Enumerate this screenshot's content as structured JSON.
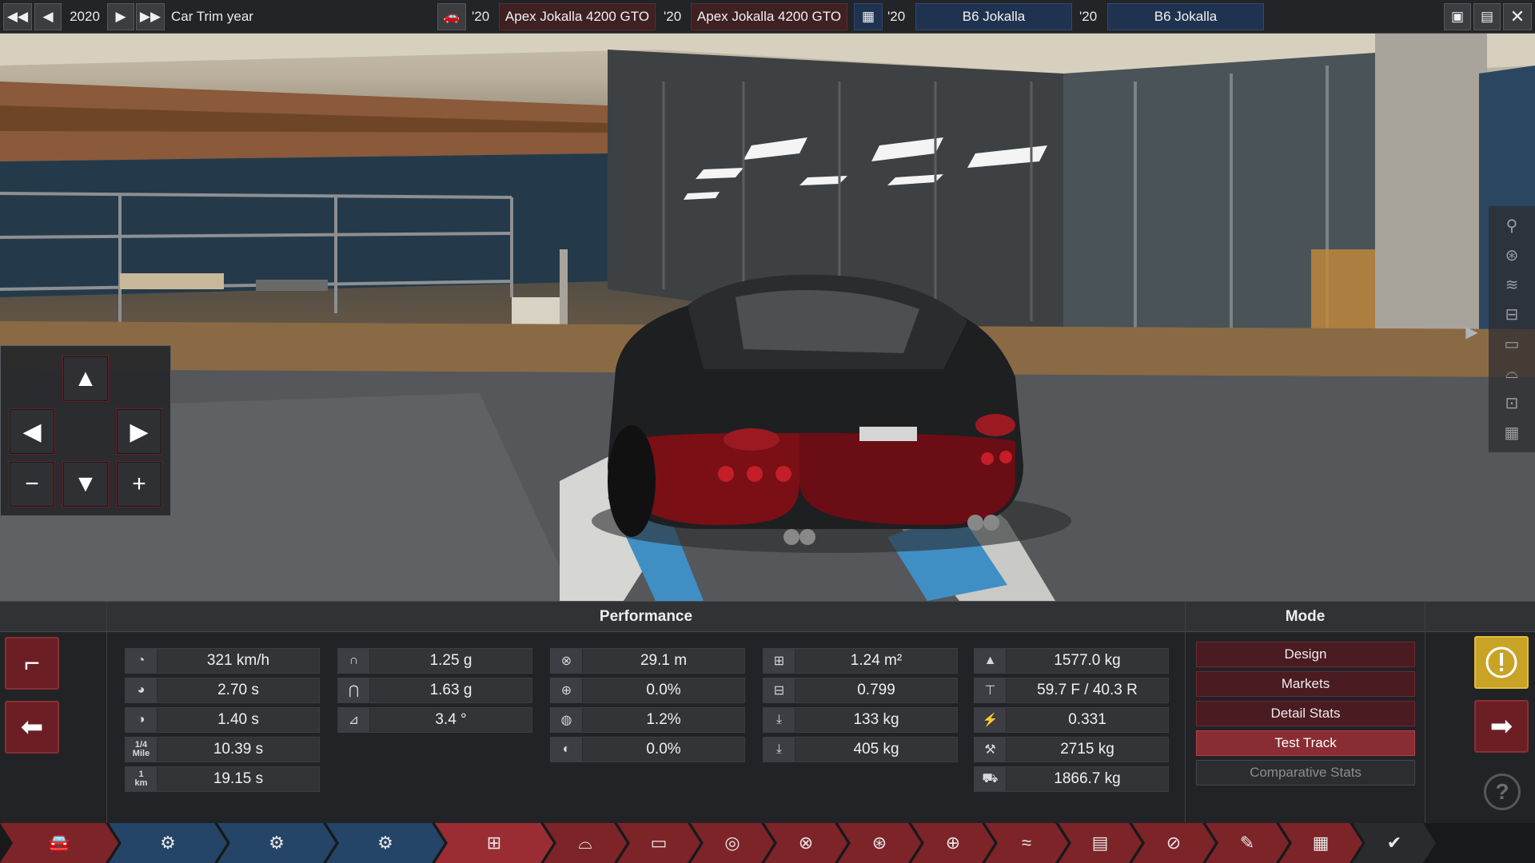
{
  "topbar": {
    "year": "2020",
    "trim_label": "Car Trim year",
    "slot1_year": "'20",
    "slot1_model": "Apex Jokalla 4200 GTO",
    "slot2_year": "'20",
    "slot2_model": "Apex Jokalla 4200 GTO",
    "slot3_year": "'20",
    "slot3_model": "B6 Jokalla",
    "slot4_year": "'20",
    "slot4_model": "B6 Jokalla"
  },
  "performance": {
    "title": "Performance",
    "col1": [
      {
        "icon": "top-speed-icon",
        "value": "321 km/h"
      },
      {
        "icon": "acceleration-0-100-icon",
        "value": "2.70 s"
      },
      {
        "icon": "acceleration-0-60-icon",
        "value": "1.40 s"
      },
      {
        "icon": "quarter-mile-icon",
        "value": "10.39 s",
        "icon_text_top": "1/4",
        "icon_text_bottom": "Mile"
      },
      {
        "icon": "one-km-icon",
        "value": "19.15 s",
        "icon_text_top": "1",
        "icon_text_bottom": "km"
      }
    ],
    "col2": [
      {
        "icon": "cornering-low-speed-icon",
        "value": "1.25 g"
      },
      {
        "icon": "cornering-high-speed-icon",
        "value": "1.63 g"
      },
      {
        "icon": "body-roll-icon",
        "value": "3.4 °"
      }
    ],
    "col3": [
      {
        "icon": "braking-distance-icon",
        "value": "29.1 m"
      },
      {
        "icon": "brake-fade-icon",
        "value": "0.0%"
      },
      {
        "icon": "wheel-lockup-icon",
        "value": "1.2%"
      },
      {
        "icon": "brake-lock-icon",
        "value": "0.0%"
      }
    ],
    "col4": [
      {
        "icon": "frontal-area-icon",
        "value": "1.24 m²"
      },
      {
        "icon": "drag-coefficient-icon",
        "value": "0.799"
      },
      {
        "icon": "front-downforce-icon",
        "value": "133 kg"
      },
      {
        "icon": "rear-downforce-icon",
        "value": "405 kg"
      }
    ],
    "col5": [
      {
        "icon": "weight-icon",
        "value": "1577.0 kg"
      },
      {
        "icon": "weight-distribution-icon",
        "value": "59.7 F / 40.3 R"
      },
      {
        "icon": "cg-height-icon",
        "value": "0.331"
      },
      {
        "icon": "towing-capacity-icon",
        "value": "2715 kg"
      },
      {
        "icon": "cargo-weight-icon",
        "value": "1866.7 kg"
      }
    ]
  },
  "mode": {
    "title": "Mode",
    "buttons": [
      "Design",
      "Markets",
      "Detail Stats",
      "Test Track",
      "Comparative Stats"
    ],
    "active": "Test Track"
  },
  "campad": {
    "up": "▲",
    "down": "▼",
    "left": "◀",
    "right": "▶",
    "minus": "−",
    "plus": "+"
  },
  "tabs": [
    {
      "icon": "car-model-icon",
      "style": "red"
    },
    {
      "icon": "engine-family-icon",
      "style": "blue"
    },
    {
      "icon": "engine-design-icon",
      "style": "blue"
    },
    {
      "icon": "engine-tuning-icon",
      "style": "blue"
    },
    {
      "icon": "trim-setup-icon",
      "style": "active"
    },
    {
      "icon": "body-icon",
      "style": "red"
    },
    {
      "icon": "drivetrain-icon",
      "style": "red"
    },
    {
      "icon": "suspension-icon",
      "style": "red"
    },
    {
      "icon": "brakes-icon",
      "style": "red"
    },
    {
      "icon": "wheels-icon",
      "style": "red"
    },
    {
      "icon": "steering-icon",
      "style": "red"
    },
    {
      "icon": "aero-icon",
      "style": "red"
    },
    {
      "icon": "interior-icon",
      "style": "red"
    },
    {
      "icon": "safety-icon",
      "style": "red"
    },
    {
      "icon": "fixtures-icon",
      "style": "red"
    },
    {
      "icon": "test-drive-icon",
      "style": "red"
    },
    {
      "icon": "finish-icon",
      "style": "dark"
    }
  ],
  "colors": {
    "accent_red": "#8a2c33",
    "accent_blue": "#1f3350",
    "warning_yellow": "#c9a326"
  }
}
